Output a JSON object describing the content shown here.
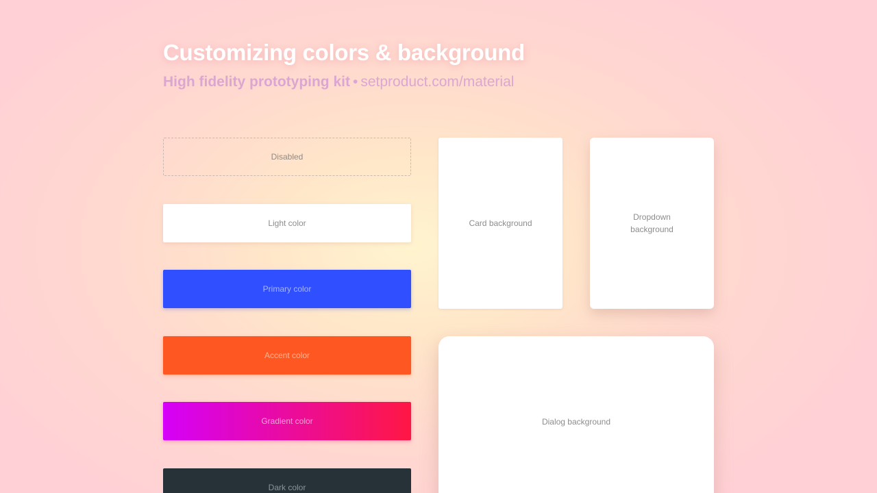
{
  "header": {
    "title": "Customizing colors & background",
    "subtitle_bold": "High fidelity prototyping kit",
    "subtitle_separator": "•",
    "subtitle_link": "setproduct.com/material"
  },
  "swatches": {
    "disabled": "Disabled",
    "light": "Light color",
    "primary": "Primary color",
    "accent": "Accent color",
    "gradient": "Gradient color",
    "dark": "Dark color"
  },
  "panels": {
    "card": "Card background",
    "dropdown": "Dropdown background",
    "dialog": "Dialog background"
  },
  "colors": {
    "primary": "#304ffe",
    "accent": "#ff5722",
    "gradient_start": "#d500f9",
    "gradient_end": "#ff1744",
    "dark": "#263238",
    "light": "#ffffff"
  }
}
